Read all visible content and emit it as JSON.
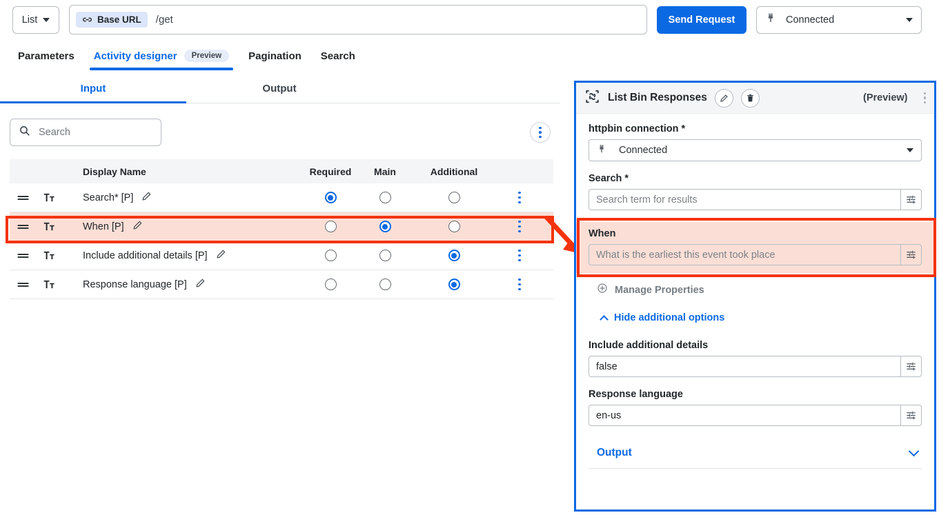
{
  "topbar": {
    "list_label": "List",
    "base_url_chip": "Base URL",
    "url_path": "/get",
    "send_label": "Send Request",
    "connection_value": "Connected",
    "plug_icon": "plug-icon",
    "link_icon": "link-icon"
  },
  "tabs": [
    {
      "label": "Parameters",
      "active": false,
      "badge": ""
    },
    {
      "label": "Activity designer",
      "active": true,
      "badge": "Preview"
    },
    {
      "label": "Pagination",
      "active": false,
      "badge": ""
    },
    {
      "label": "Search",
      "active": false,
      "badge": ""
    }
  ],
  "io_tabs": [
    {
      "label": "Input",
      "active": true
    },
    {
      "label": "Output",
      "active": false
    }
  ],
  "search": {
    "placeholder": "Search",
    "value": "",
    "icon": "search-icon"
  },
  "table": {
    "columns": [
      "Display Name",
      "Required",
      "Main",
      "Additional"
    ],
    "rows": [
      {
        "name": "Search* [P]",
        "required": true,
        "main": false,
        "additional": false,
        "highlighted": false
      },
      {
        "name": "When [P]",
        "required": false,
        "main": true,
        "additional": false,
        "highlighted": true
      },
      {
        "name": "Include additional details [P]",
        "required": false,
        "main": false,
        "additional": true,
        "highlighted": false
      },
      {
        "name": "Response language [P]",
        "required": false,
        "main": false,
        "additional": true,
        "highlighted": false
      }
    ]
  },
  "panel": {
    "title": "List Bin Responses",
    "preview_label": "(Preview)",
    "edit_icon": "pencil-icon",
    "delete_icon": "trash-icon",
    "kebab_icon": "kebab-menu-icon",
    "activity_icon": "activity-shuffle-icon",
    "connection": {
      "label": "httpbin connection *",
      "value": "Connected"
    },
    "fields": [
      {
        "label": "Search *",
        "placeholder": "Search term for results",
        "value": "",
        "highlighted": false
      },
      {
        "label": "When",
        "placeholder": "What is the earliest this event took place",
        "value": "",
        "highlighted": true
      },
      {
        "label": "Include additional details",
        "placeholder": "",
        "value": "false",
        "highlighted": false
      },
      {
        "label": "Response language",
        "placeholder": "",
        "value": "en-us",
        "highlighted": false
      }
    ],
    "manage_properties": "Manage Properties",
    "hide_additional_options": "Hide additional options",
    "output_label": "Output"
  },
  "colors": {
    "accent_blue": "#0b69e3",
    "highlight_red": "#f4330c",
    "highlight_fill": "#fbdfd6",
    "chip_blue": "#dce6fb"
  }
}
